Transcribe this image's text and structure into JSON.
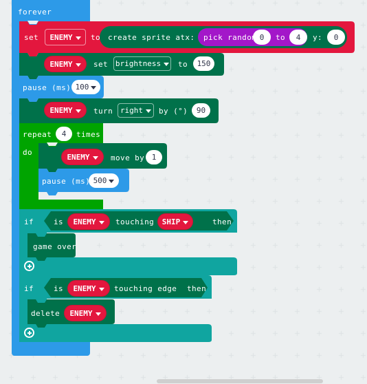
{
  "app": {
    "name": "makecode-block-editor",
    "workspace_background": "#eceff0"
  },
  "palette": {
    "loops_blue": "#2d9ae8",
    "loops_green": "#00a400",
    "variables_red": "#e3173e",
    "sprites_green": "#00714a",
    "logic_teal": "#10a5a0",
    "math_purple": "#a317c9",
    "field_white": "#ffffff",
    "text_white": "#ffffff",
    "text_dark": "#30354a"
  },
  "program": {
    "forever": {
      "label": "forever",
      "statements": [
        {
          "id": "set-enemy",
          "kind": "variables-set",
          "label_set": "set",
          "variable": "ENEMY",
          "label_to": "to",
          "value": {
            "id": "create-sprite",
            "kind": "sprite-create",
            "label_prefix": "create sprite atx:",
            "x_value": {
              "id": "pick-random",
              "kind": "math-random",
              "label": "pick random",
              "from": "0",
              "label_to": "to",
              "to": "4"
            },
            "label_y": "y:",
            "y_value": "0"
          }
        },
        {
          "id": "set-brightness",
          "kind": "sprite-set-property",
          "variable": "ENEMY",
          "label_set": "set",
          "property": "brightness",
          "label_to": "to",
          "value": "150"
        },
        {
          "id": "pause-100",
          "kind": "basic-pause",
          "label": "pause (ms)",
          "value": "100"
        },
        {
          "id": "turn-right",
          "kind": "sprite-turn",
          "variable": "ENEMY",
          "label_turn": "turn",
          "direction": "right",
          "label_by": "by (°)",
          "value": "90"
        },
        {
          "id": "repeat-4",
          "kind": "loops-repeat",
          "label_repeat": "repeat",
          "count": "4",
          "label_times": "times",
          "label_do": "do",
          "body": [
            {
              "id": "move-by",
              "kind": "sprite-move",
              "variable": "ENEMY",
              "label_move": "move by",
              "value": "1"
            },
            {
              "id": "pause-500",
              "kind": "basic-pause",
              "label": "pause (ms)",
              "value": "500"
            }
          ]
        },
        {
          "id": "if-touching-ship",
          "kind": "logic-if",
          "label_if": "if",
          "label_then": "then",
          "condition": {
            "kind": "sprite-is-touching",
            "label_is": "is",
            "variable": "ENEMY",
            "label_touching": "touching",
            "target": "SHIP"
          },
          "body": [
            {
              "id": "game-over",
              "kind": "game-over",
              "label": "game over"
            }
          ],
          "expand_icon": "plus-circle-icon"
        },
        {
          "id": "if-touching-edge",
          "kind": "logic-if",
          "label_if": "if",
          "label_then": "then",
          "condition": {
            "kind": "sprite-is-touching-edge",
            "label_is": "is",
            "variable": "ENEMY",
            "label_touching": "touching edge"
          },
          "body": [
            {
              "id": "delete-enemy",
              "kind": "sprite-delete",
              "label": "delete",
              "variable": "ENEMY"
            }
          ],
          "expand_icon": "plus-circle-icon"
        }
      ]
    }
  },
  "scrollbar": {
    "orientation": "horizontal",
    "name": "workspace-horizontal-scrollbar"
  }
}
